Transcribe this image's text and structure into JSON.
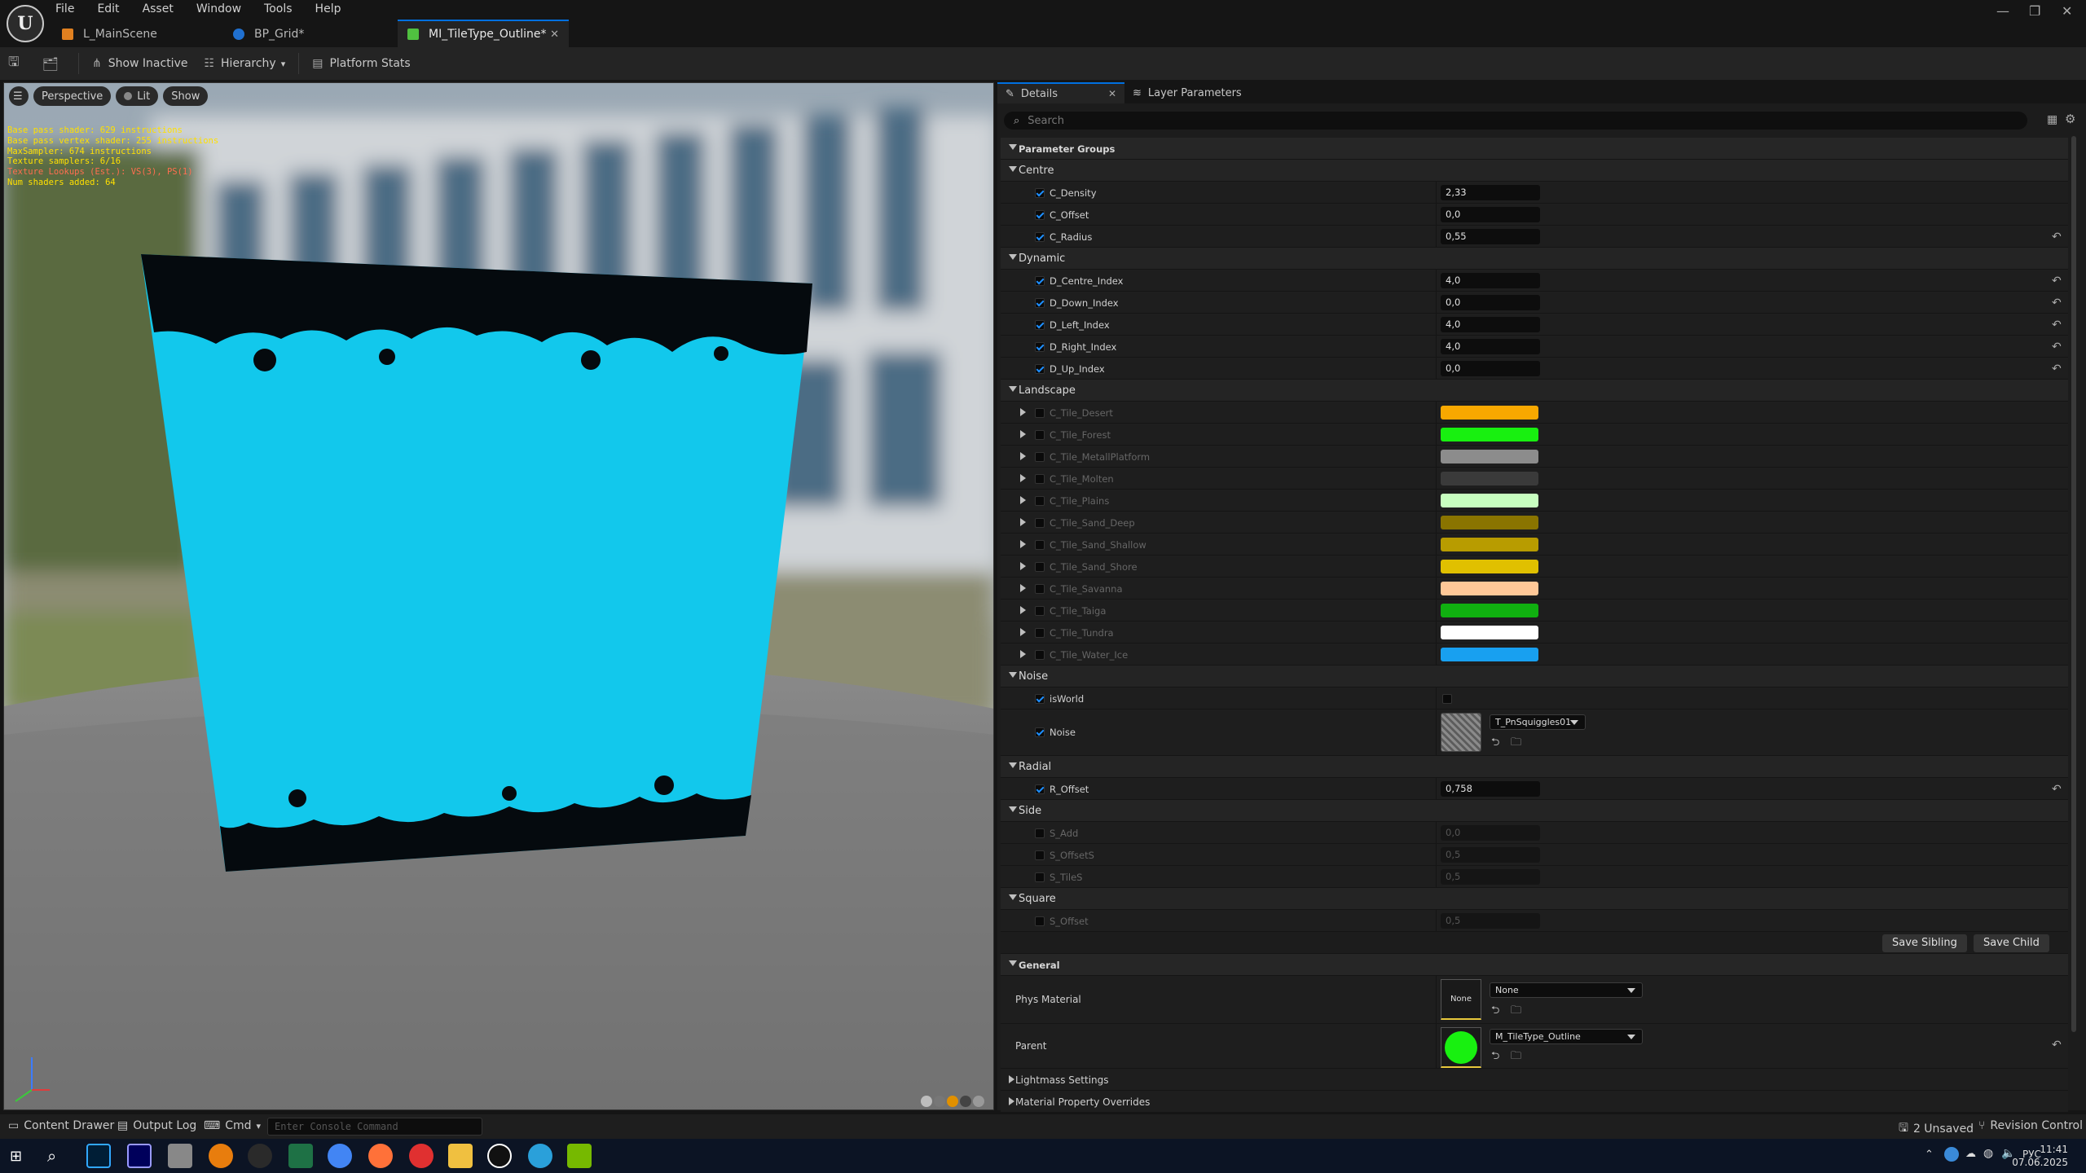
{
  "menu": [
    "File",
    "Edit",
    "Asset",
    "Window",
    "Tools",
    "Help"
  ],
  "tabs": [
    {
      "label": "L_MainScene",
      "color": "#e08020"
    },
    {
      "label": "BP_Grid*",
      "color": "#2070d0"
    },
    {
      "label": "MI_TileType_Outline*",
      "color": "#50c040"
    }
  ],
  "toolbar": {
    "show_inactive": "Show Inactive",
    "hierarchy": "Hierarchy",
    "platform_stats": "Platform Stats"
  },
  "viewport": {
    "perspective": "Perspective",
    "lit": "Lit",
    "show": "Show",
    "stats": [
      "Base pass shader: 629 instructions",
      "Base pass vertex shader: 255 instructions",
      "MaxSampler: 674 instructions",
      "Texture samplers: 6/16",
      "Texture Lookups (Est.): VS(3), PS(1)",
      "Num shaders added: 64"
    ]
  },
  "panel": {
    "details_tab": "Details",
    "layer_tab": "Layer Parameters",
    "search_placeholder": "Search",
    "parameter_groups": "Parameter Groups",
    "groups": {
      "centre": "Centre",
      "dynamic": "Dynamic",
      "landscape": "Landscape",
      "noise": "Noise",
      "radial": "Radial",
      "side": "Side",
      "square": "Square"
    },
    "centre_params": [
      {
        "name": "C_Density",
        "value": "2,33",
        "reset": false
      },
      {
        "name": "C_Offset",
        "value": "0,0",
        "reset": false
      },
      {
        "name": "C_Radius",
        "value": "0,55",
        "reset": true
      }
    ],
    "dynamic_params": [
      {
        "name": "D_Centre_Index",
        "value": "4,0"
      },
      {
        "name": "D_Down_Index",
        "value": "0,0"
      },
      {
        "name": "D_Left_Index",
        "value": "4,0"
      },
      {
        "name": "D_Right_Index",
        "value": "4,0"
      },
      {
        "name": "D_Up_Index",
        "value": "0,0"
      }
    ],
    "landscape_params": [
      {
        "name": "C_Tile_Desert",
        "color": "#f8a800"
      },
      {
        "name": "C_Tile_Forest",
        "color": "#18f010"
      },
      {
        "name": "C_Tile_MetallPlatform",
        "color": "#8c8c8c"
      },
      {
        "name": "C_Tile_Molten",
        "color": "#3a3a3a"
      },
      {
        "name": "C_Tile_Plains",
        "color": "#c8ffc0"
      },
      {
        "name": "C_Tile_Sand_Deep",
        "color": "#8a7400"
      },
      {
        "name": "C_Tile_Sand_Shallow",
        "color": "#b89c00"
      },
      {
        "name": "C_Tile_Sand_Shore",
        "color": "#e0c000"
      },
      {
        "name": "C_Tile_Savanna",
        "color": "#ffc898"
      },
      {
        "name": "C_Tile_Taiga",
        "color": "#10b010"
      },
      {
        "name": "C_Tile_Tundra",
        "color": "#ffffff"
      },
      {
        "name": "C_Tile_Water_Ice",
        "color": "#18a0f0"
      }
    ],
    "noise": {
      "is_world": "isWorld",
      "noise": "Noise",
      "texture": "T_PnSquiggles01"
    },
    "radial": {
      "name": "R_Offset",
      "value": "0,758"
    },
    "side_params": [
      {
        "name": "S_Add",
        "value": "0,0"
      },
      {
        "name": "S_OffsetS",
        "value": "0,5"
      },
      {
        "name": "S_TileS",
        "value": "0,5"
      }
    ],
    "square": {
      "name": "S_Offset",
      "value": "0,5"
    },
    "save_sibling": "Save Sibling",
    "save_child": "Save Child",
    "general": "General",
    "phys_material": "Phys Material",
    "phys_value": "None",
    "phys_thumb": "None",
    "parent": "Parent",
    "parent_value": "M_TileType_Outline",
    "lightmass": "Lightmass Settings",
    "mpo": "Material Property Overrides"
  },
  "status": {
    "content_drawer": "Content Drawer",
    "output_log": "Output Log",
    "cmd": "Cmd",
    "console_placeholder": "Enter Console Command",
    "unsaved": "2 Unsaved",
    "revision": "Revision Control"
  },
  "clock": {
    "time": "11:41",
    "date": "07.06.2025",
    "lang": "РУС"
  }
}
